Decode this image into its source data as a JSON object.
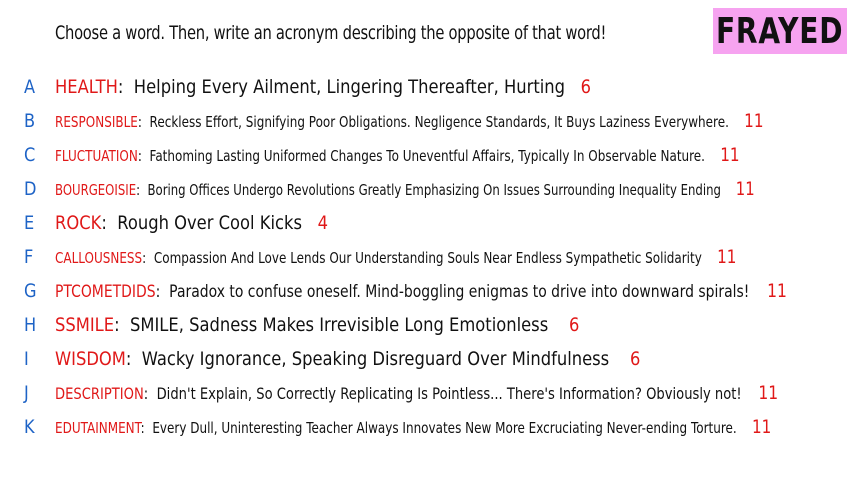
{
  "prompt": "Choose a word. Then, write an acronym describing the opposite of that word!",
  "badge": "FRAYED",
  "colors": {
    "letter": "#1e63c6",
    "word": "#e01818",
    "count": "#e01818",
    "badge_bg": "#f6a3f0"
  },
  "rows": [
    {
      "letter": "A",
      "word": "HEALTH",
      "acronym": "Helping Every Ailment, Lingering Thereafter, Hurting",
      "count": "6"
    },
    {
      "letter": "B",
      "word": "RESPONSIBLE",
      "acronym": "Reckless Effort, Signifying Poor Obligations. Negligence Standards, It Buys Laziness Everywhere.",
      "count": "11"
    },
    {
      "letter": "C",
      "word": "FLUCTUATION",
      "acronym": "Fathoming Lasting Uniformed Changes To Uneventful Affairs, Typically In Observable Nature.",
      "count": "11"
    },
    {
      "letter": "D",
      "word": "BOURGEOISIE",
      "acronym": "Boring Offices Undergo Revolutions Greatly Emphasizing On Issues Surrounding Inequality Ending",
      "count": "11"
    },
    {
      "letter": "E",
      "word": "ROCK",
      "acronym": "Rough Over Cool Kicks",
      "count": "4"
    },
    {
      "letter": "F",
      "word": "CALLOUSNESS",
      "acronym": "Compassion And Love Lends Our Understanding Souls Near Endless Sympathetic Solidarity",
      "count": "11"
    },
    {
      "letter": "G",
      "word": "PTCOMETDIDS",
      "acronym": "Paradox to confuse oneself. Mind-boggling enigmas to drive into downward spirals!",
      "count": "11"
    },
    {
      "letter": "H",
      "word": "SSMILE",
      "acronym": "SMILE, Sadness Makes Irrevisible Long Emotionless",
      "count": "6"
    },
    {
      "letter": "I",
      "word": "WISDOM",
      "acronym": "Wacky Ignorance, Speaking Disreguard Over Mindfulness",
      "count": "6"
    },
    {
      "letter": "J",
      "word": "DESCRIPTION",
      "acronym": "Didn't Explain, So Correctly Replicating Is Pointless... There's Information? Obviously not!",
      "count": "11"
    },
    {
      "letter": "K",
      "word": "EDUTAINMENT",
      "acronym": "Every Dull, Uninteresting Teacher Always Innovates New More Excruciating Never-ending Torture.",
      "count": "11"
    }
  ]
}
